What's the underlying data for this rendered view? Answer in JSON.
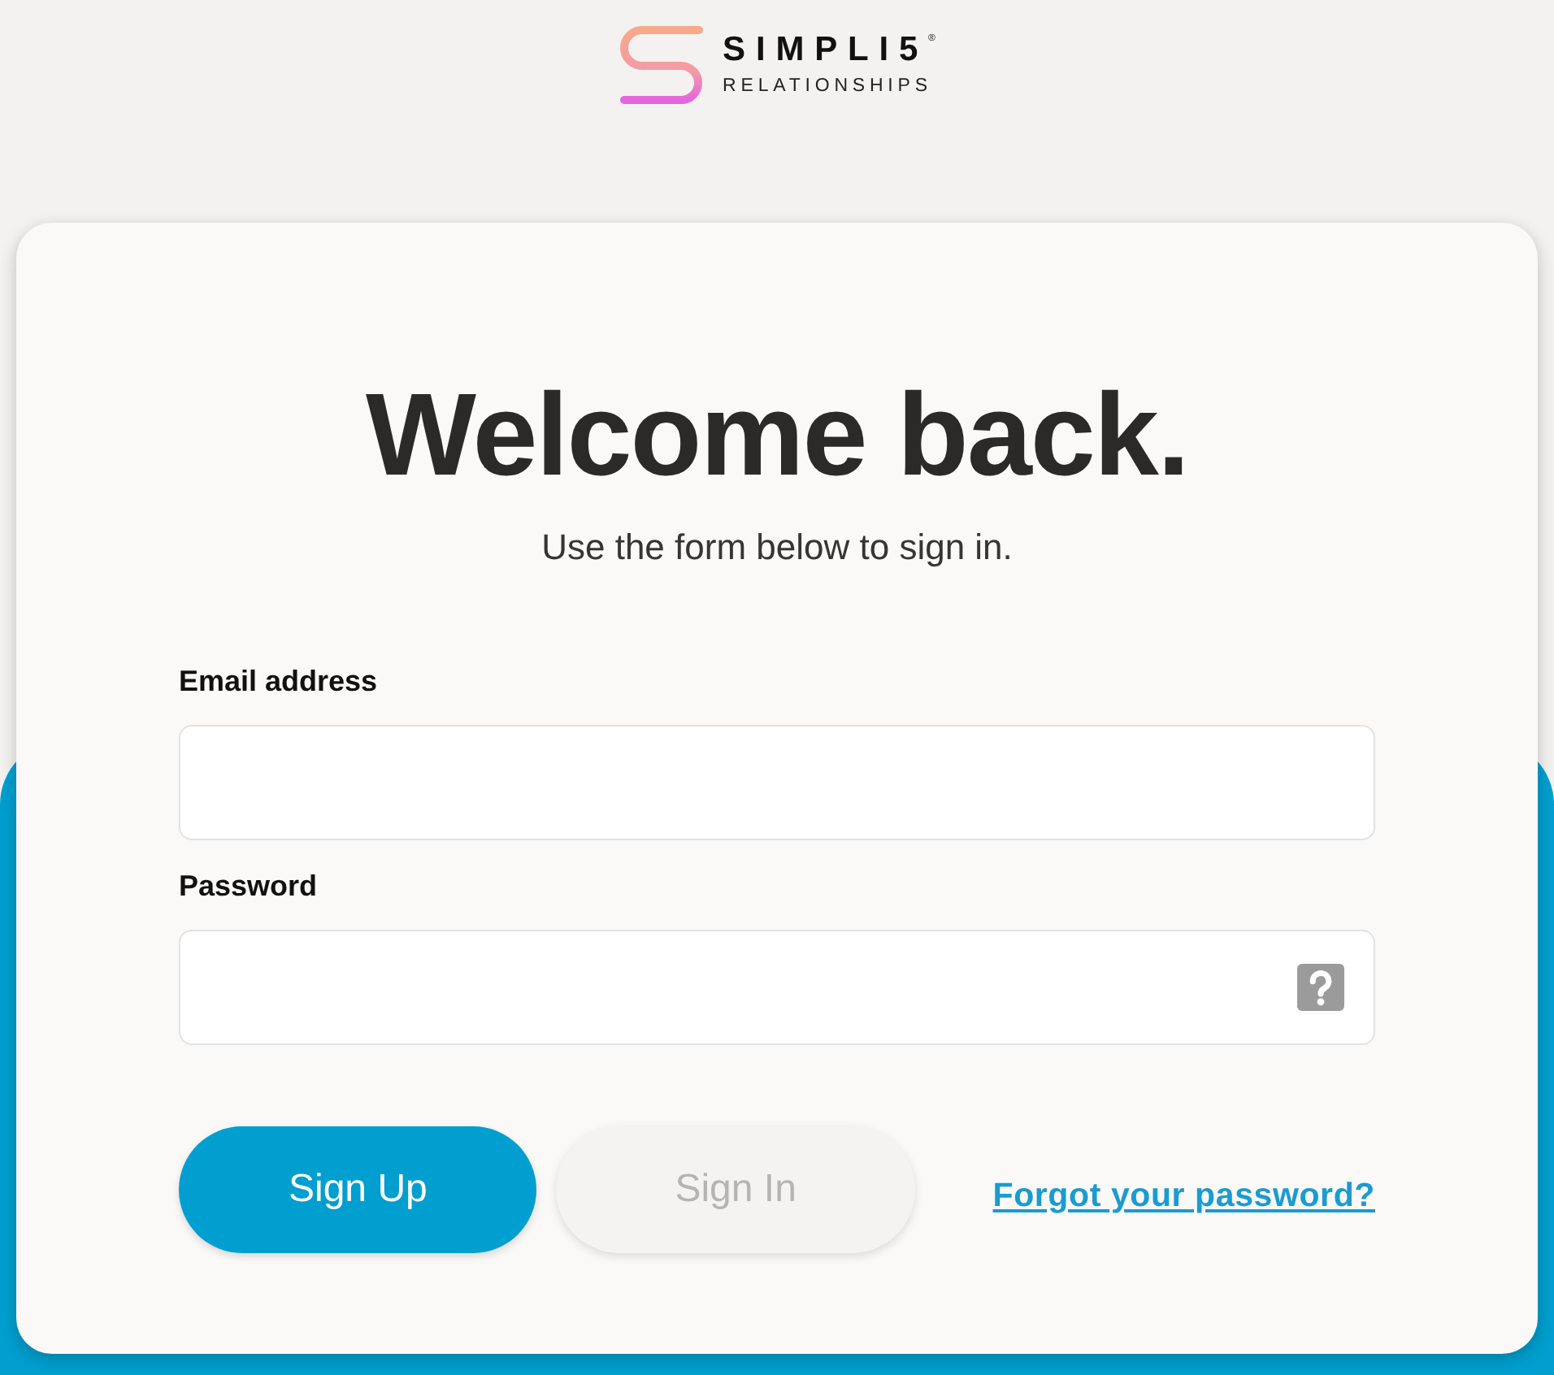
{
  "logo": {
    "name": "SIMPLI5$^{®}$",
    "tagline": "RELATIONSHIPS"
  },
  "card": {
    "title": "Welcome back.",
    "subtitle": "Use the form below to sign in.",
    "fields": [
      {
        "label": "Email address",
        "help": false
      },
      {
        "label": "Password",
        "help": true
      }
    ],
    "buttons": [
      {
        "label": "Sign Up",
        "disabled": false
      },
      {
        "label": "Sign In",
        "disabled": true
      }
    ],
    "link": "Forgot your password?"
  }
}
